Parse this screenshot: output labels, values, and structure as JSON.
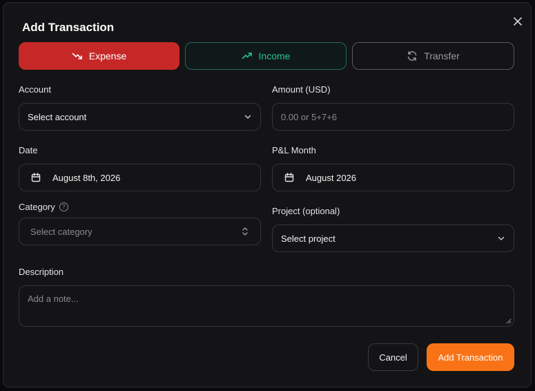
{
  "dialog": {
    "title": "Add Transaction"
  },
  "type_buttons": {
    "expense": "Expense",
    "income": "Income",
    "transfer": "Transfer",
    "active": "expense"
  },
  "fields": {
    "account": {
      "label": "Account",
      "value": "Select account"
    },
    "amount": {
      "label": "Amount (USD)",
      "placeholder": "0.00 or 5+7+6"
    },
    "date": {
      "label": "Date",
      "value": "August 8th, 2026"
    },
    "pl_month": {
      "label": "P&L Month",
      "value": "August 2026"
    },
    "category": {
      "label": "Category",
      "placeholder": "Select category"
    },
    "project": {
      "label": "Project (optional)",
      "value": "Select project"
    },
    "description": {
      "label": "Description",
      "placeholder": "Add a note..."
    }
  },
  "actions": {
    "cancel": "Cancel",
    "submit": "Add Transaction"
  },
  "colors": {
    "expense_bg": "#c62828",
    "income_accent": "#22c58b",
    "submit_bg": "#f97316",
    "dialog_bg": "#141416"
  }
}
